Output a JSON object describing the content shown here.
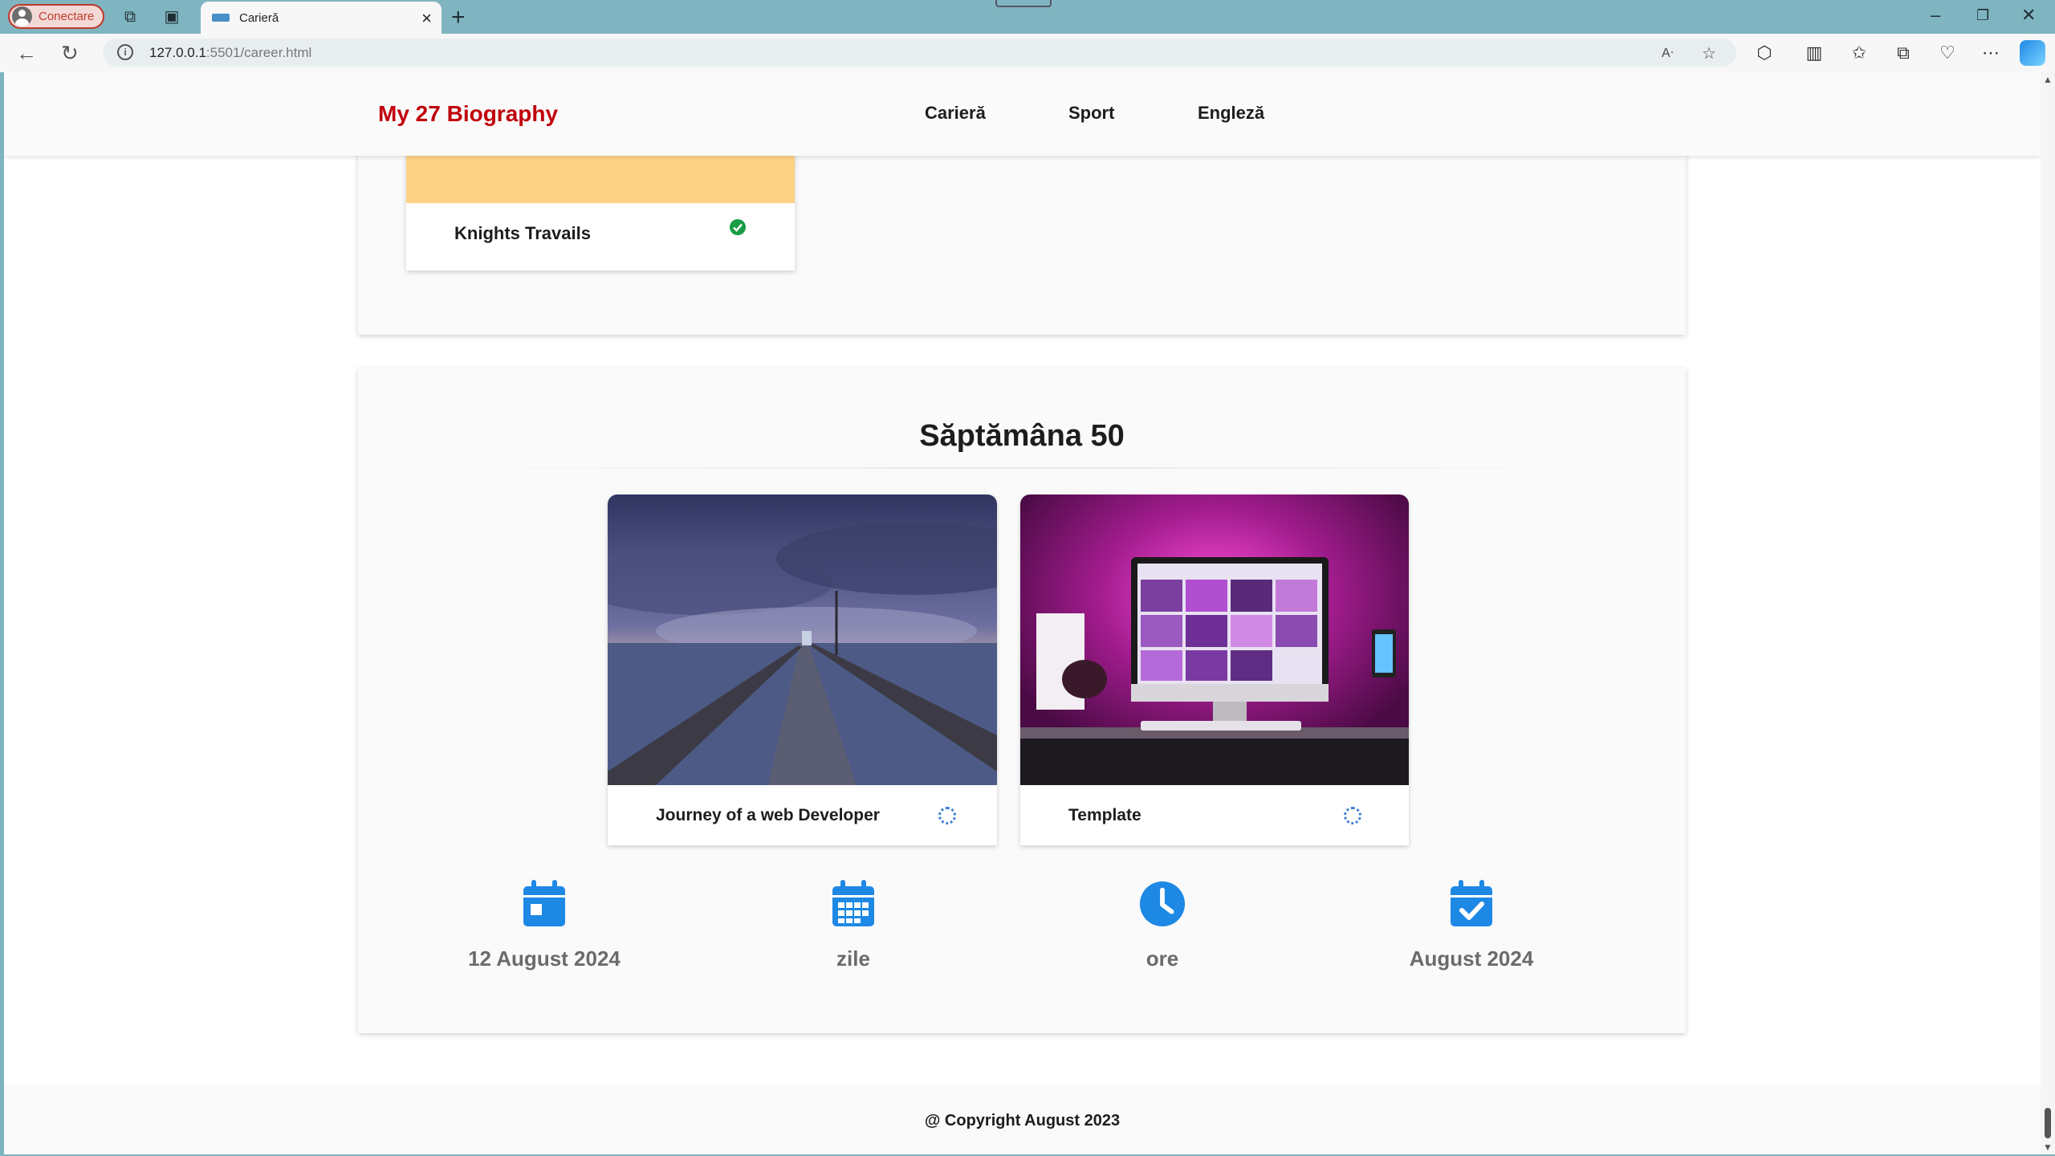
{
  "browser": {
    "profile_label": "Conectare",
    "tab_title": "Carieră",
    "url_host": "127.0.0.1",
    "url_rest": ":5501/career.html"
  },
  "header": {
    "brand": "My 27 Biography",
    "nav": [
      "Carieră",
      "Sport",
      "Engleză"
    ]
  },
  "previous_section": {
    "card_caption": "Knights Travails",
    "card_status": "completed",
    "thumb_color": "#ffd385"
  },
  "week_section": {
    "title": "Săptămâna 50",
    "cards": [
      {
        "caption": "Journey of a web Developer",
        "status": "loading",
        "image": "pier at dusk over the sea"
      },
      {
        "caption": "Template",
        "status": "loading",
        "image": "desktop computer with pink purple backlight"
      }
    ],
    "stats": [
      {
        "icon": "calendar-icon",
        "value": "12 August 2024"
      },
      {
        "icon": "calendar-days-icon",
        "value": "zile"
      },
      {
        "icon": "clock-icon",
        "value": "ore"
      },
      {
        "icon": "calendar-check-icon",
        "value": "August 2024"
      }
    ]
  },
  "footer": {
    "text": "@ Copyright August 2023"
  },
  "colors": {
    "brand": "#c0000c",
    "accent": "#1e88e5",
    "success": "#1a9c46"
  }
}
